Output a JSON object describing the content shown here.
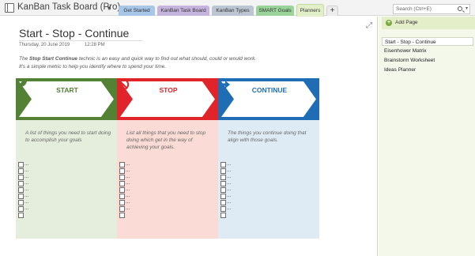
{
  "notebook": {
    "title": "KanBan Task Board (Pro)",
    "tabs": [
      {
        "label": "Get Started"
      },
      {
        "label": "KanBan Task Board"
      },
      {
        "label": "KanBan Types"
      },
      {
        "label": "SMART Goals"
      },
      {
        "label": "Planners"
      }
    ],
    "add_tab": "+"
  },
  "search": {
    "placeholder": "Search (Ctrl+E)"
  },
  "page": {
    "title": "Start - Stop - Continue",
    "date": "Thursday, 20 June 2019",
    "time": "12:28 PM",
    "intro_line1_pre": "The ",
    "intro_line1_bold": "Stop Start Continue",
    "intro_line1_post": " technic is an easy and quick way to find out what should, could or would work.",
    "intro_line2": "It's a simple metric to help you identify where to spend your time."
  },
  "columns": [
    {
      "label": "START",
      "icon": "rocket-icon",
      "color": "#538135",
      "description": "A list of things you need to start doing to accomplish your goals",
      "items": [
        "...",
        "...",
        "...",
        "...",
        "...",
        "...",
        "...",
        "...",
        ""
      ]
    },
    {
      "label": "STOP",
      "icon": "no-entry-icon",
      "color": "#e0242a",
      "description": "List all things that you need to stop doing which get in the way of achieving your goals.",
      "items": [
        "...",
        "...",
        "...",
        "...",
        "...",
        "...",
        "...",
        "...",
        ""
      ]
    },
    {
      "label": "CONTINUE",
      "icon": "arrow-right-icon",
      "color": "#1f6eb5",
      "description": "The things you continue doing that align with those goals.",
      "items": [
        "...",
        "...",
        "...",
        "...",
        "...",
        "...",
        "...",
        "...",
        ""
      ]
    }
  ],
  "sidebar": {
    "add_page": "Add Page",
    "pages": [
      {
        "label": "Start - Stop - Continue"
      },
      {
        "label": "Eisenhower Matrix"
      },
      {
        "label": "Brainstorm Worksheet"
      },
      {
        "label": "Ideas Planner"
      }
    ]
  }
}
